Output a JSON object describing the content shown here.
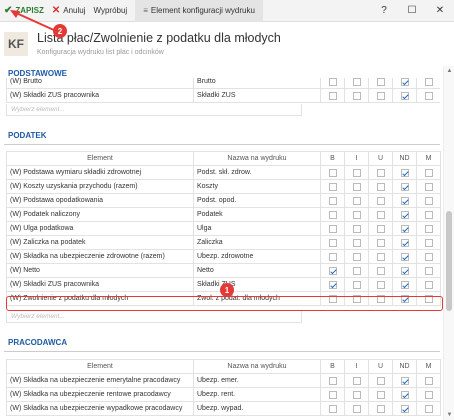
{
  "toolbar": {
    "save": "ZAPISZ",
    "cancel": "Anuluj",
    "try": "Wypróbuj",
    "title": "Element konfiguracji wydruku",
    "help": "?",
    "minimize": "☐",
    "close": "✕"
  },
  "header": {
    "badge": "KF",
    "title": "Lista płac/Zwolnienie z podatku dla młodych",
    "subtitle": "Konfiguracja wydruku list płac i odcinków"
  },
  "podstawowe": {
    "title": "PODSTAWOWE",
    "rows": [
      {
        "element": "(W) Brutto",
        "name": "Brutto",
        "b": false,
        "i": false,
        "u": false,
        "nd": true,
        "m": false
      },
      {
        "element": "(W) Składki ZUS pracownika",
        "name": "Składki ZUS",
        "b": false,
        "i": false,
        "u": false,
        "nd": true,
        "m": false
      }
    ],
    "add_placeholder": "Wybierz element..."
  },
  "columns": {
    "element": "Element",
    "name": "Nazwa na wydruku",
    "b": "B",
    "i": "I",
    "u": "U",
    "nd": "ND",
    "m": "M"
  },
  "podatek": {
    "title": "PODATEK",
    "rows": [
      {
        "element": "(W) Podstawa wymiaru składki zdrowotnej",
        "name": "Podst. skł. zdrow.",
        "b": false,
        "i": false,
        "u": false,
        "nd": true,
        "m": false
      },
      {
        "element": "(W) Koszty uzyskania przychodu (razem)",
        "name": "Koszty",
        "b": false,
        "i": false,
        "u": false,
        "nd": true,
        "m": false
      },
      {
        "element": "(W) Podstawa opodatkowania",
        "name": "Podst. opod.",
        "b": false,
        "i": false,
        "u": false,
        "nd": true,
        "m": false
      },
      {
        "element": "(W) Podatek naliczony",
        "name": "Podatek",
        "b": false,
        "i": false,
        "u": false,
        "nd": true,
        "m": false
      },
      {
        "element": "(W) Ulga podatkowa",
        "name": "Ulga",
        "b": false,
        "i": false,
        "u": false,
        "nd": true,
        "m": false
      },
      {
        "element": "(W) Zaliczka na podatek",
        "name": "Zaliczka",
        "b": false,
        "i": false,
        "u": false,
        "nd": true,
        "m": false
      },
      {
        "element": "(W) Składka na ubezpieczenie zdrowotne (razem)",
        "name": "Ubezp. zdrowotne",
        "b": false,
        "i": false,
        "u": false,
        "nd": true,
        "m": false
      },
      {
        "element": "(W) Netto",
        "name": "Netto",
        "b": true,
        "i": false,
        "u": false,
        "nd": true,
        "m": false
      },
      {
        "element": "(W) Składki ZUS pracownika",
        "name": "Składki ZUS",
        "b": true,
        "i": false,
        "u": false,
        "nd": true,
        "m": false
      },
      {
        "element": "(W) Zwolnienie z podatku dla młodych",
        "name": "Zwol. z podat. dla młodych",
        "b": false,
        "i": false,
        "u": false,
        "nd": true,
        "m": false
      }
    ],
    "add_placeholder": "Wybierz element..."
  },
  "pracodawca": {
    "title": "PRACODAWCA",
    "rows": [
      {
        "element": "(W) Składka na ubezpieczenie emerytalne pracodawcy",
        "name": "Ubezp. emer.",
        "b": false,
        "i": false,
        "u": false,
        "nd": true,
        "m": false
      },
      {
        "element": "(W) Składka na ubezpieczenie rentowe pracodawcy",
        "name": "Ubezp. rent.",
        "b": false,
        "i": false,
        "u": false,
        "nd": true,
        "m": false
      },
      {
        "element": "(W) Składka na ubezpieczenie wypadkowe pracodawcy",
        "name": "Ubezp. wypad.",
        "b": false,
        "i": false,
        "u": false,
        "nd": true,
        "m": false
      }
    ]
  },
  "annotations": {
    "one": "1",
    "two": "2"
  },
  "colors": {
    "accent": "#1e5aa5",
    "highlight": "#e53935",
    "save": "#2e7d32"
  }
}
